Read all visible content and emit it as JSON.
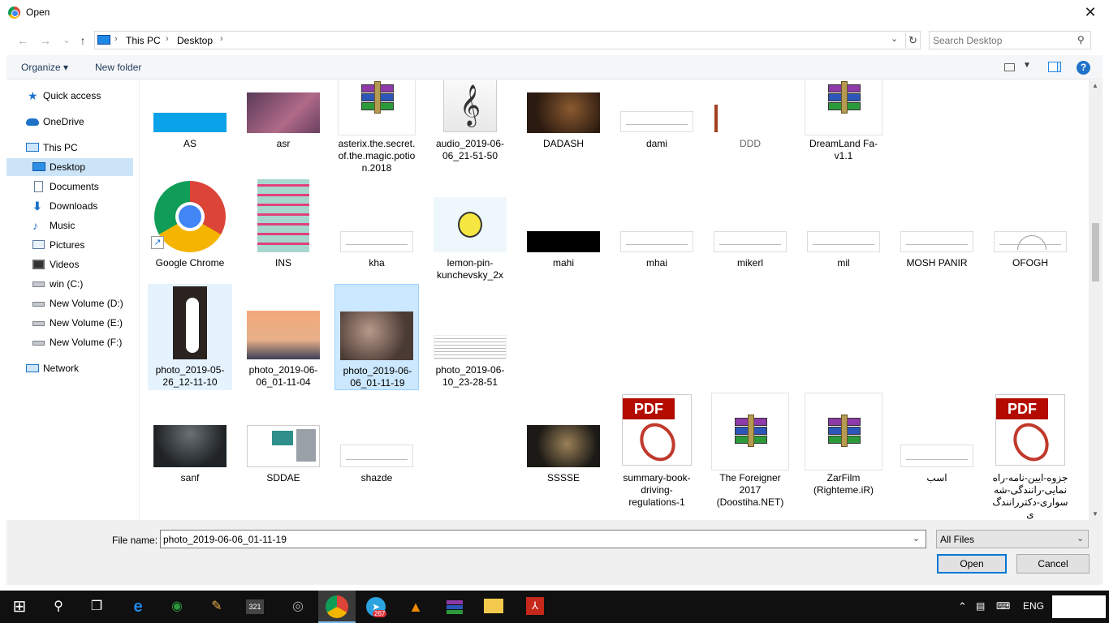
{
  "window": {
    "title": "Open",
    "close_glyph": "✕"
  },
  "nav": {
    "back_glyph": "←",
    "forward_glyph": "→",
    "recent_glyph": "⌄",
    "up_glyph": "↑",
    "breadcrumb": [
      "This PC",
      "Desktop"
    ],
    "sep_glyph": "›",
    "search_placeholder": "Search Desktop"
  },
  "toolbar": {
    "organize": "Organize ▾",
    "new_folder": "New folder",
    "help": "?"
  },
  "sidebar": {
    "items": [
      {
        "label": "Quick access",
        "icon": "star-icon"
      },
      {
        "label": "OneDrive",
        "icon": "cloud-icon"
      },
      {
        "label": "This PC",
        "icon": "computer-icon"
      },
      {
        "label": "Desktop",
        "icon": "desktop-icon",
        "selected": true
      },
      {
        "label": "Documents",
        "icon": "document-icon"
      },
      {
        "label": "Downloads",
        "icon": "download-icon"
      },
      {
        "label": "Music",
        "icon": "music-icon"
      },
      {
        "label": "Pictures",
        "icon": "pictures-icon"
      },
      {
        "label": "Videos",
        "icon": "videos-icon"
      },
      {
        "label": "win (C:)",
        "icon": "drive-icon"
      },
      {
        "label": "New Volume (D:)",
        "icon": "drive-icon"
      },
      {
        "label": "New Volume (E:)",
        "icon": "drive-icon"
      },
      {
        "label": "New Volume (F:)",
        "icon": "drive-icon"
      },
      {
        "label": "Network",
        "icon": "network-icon"
      }
    ]
  },
  "files": [
    {
      "name": "AS",
      "kind": "image-blue",
      "colors": [
        "#0aa2e8"
      ]
    },
    {
      "name": "asr",
      "kind": "photo",
      "colors": [
        "#5a3b58",
        "#b06a88"
      ]
    },
    {
      "name": "asterix.the.secret.of.the.magic.potion.2018",
      "kind": "rar"
    },
    {
      "name": "audio_2019-06-06_21-51-50",
      "kind": "audio"
    },
    {
      "name": "DADASH",
      "kind": "photo",
      "colors": [
        "#2b1a10",
        "#8a5a30"
      ]
    },
    {
      "name": "dami",
      "kind": "sketch"
    },
    {
      "name": "DDD",
      "kind": "partial"
    },
    {
      "name": "DreamLand Fa-v1.1",
      "kind": "rar"
    },
    {
      "name": "Google Chrome",
      "kind": "chrome"
    },
    {
      "name": "INS",
      "kind": "poster",
      "colors": [
        "#a7d7cf",
        "#e0417a"
      ]
    },
    {
      "name": "kha",
      "kind": "sketch"
    },
    {
      "name": "lemon-pin-kunchevsky_2x",
      "kind": "lemon"
    },
    {
      "name": "mahi",
      "kind": "photo",
      "colors": [
        "#000000",
        "#000000"
      ]
    },
    {
      "name": "mhai",
      "kind": "sketch"
    },
    {
      "name": "mikerl",
      "kind": "sketch"
    },
    {
      "name": "mil",
      "kind": "sketch"
    },
    {
      "name": "MOSH PANIR",
      "kind": "sketch"
    },
    {
      "name": "OFOGH",
      "kind": "sketch"
    },
    {
      "name": "photo_2019-05-26_12-11-10",
      "kind": "tall-photo",
      "colors": [
        "#2a2320",
        "#ffffff"
      ],
      "state": "selected-light"
    },
    {
      "name": "photo_2019-06-06_01-11-04",
      "kind": "photo",
      "colors": [
        "#f2a878",
        "#3b3f55"
      ]
    },
    {
      "name": "photo_2019-06-06_01-11-19",
      "kind": "photo",
      "colors": [
        "#4a3a34",
        "#b89a8a"
      ],
      "state": "selected"
    },
    {
      "name": "photo_2019-06-10_23-28-51",
      "kind": "text-image"
    },
    {
      "name": "sanf",
      "kind": "photo",
      "colors": [
        "#1f2326",
        "#4a5054"
      ]
    },
    {
      "name": "SDDAE",
      "kind": "screenshot",
      "colors": [
        "#ffffff",
        "#2f8f8a"
      ]
    },
    {
      "name": "shazde",
      "kind": "sketch"
    },
    {
      "name": "SSSSE",
      "kind": "photo",
      "colors": [
        "#1c1a16",
        "#9a8058"
      ]
    },
    {
      "name": "summary-book-driving-regulations-1",
      "kind": "pdf"
    },
    {
      "name": "The Foreigner 2017 (Doostiha.NET)",
      "kind": "rar"
    },
    {
      "name": "ZarFilm (Righteme.iR)",
      "kind": "rar"
    },
    {
      "name": "اسب",
      "kind": "sketch"
    },
    {
      "name": "جزوه-ایین-نامه-راه نمایی-رانندگی-شه سواری-دکتررانندگ ی",
      "kind": "pdf"
    }
  ],
  "pdf_tag": "PDF",
  "shortcut_glyph": "↗",
  "audio_glyph": "𝄞",
  "footer": {
    "file_name_label": "File name:",
    "file_name_value": "photo_2019-06-06_01-11-19",
    "file_type": "All Files",
    "open": "Open",
    "cancel": "Cancel"
  },
  "taskbar": {
    "start_glyph": "⊞",
    "search_glyph": "⚲",
    "taskview_glyph": "❐",
    "telegram_badge": "267",
    "language": "ENG",
    "tray_up_glyph": "⌃"
  }
}
